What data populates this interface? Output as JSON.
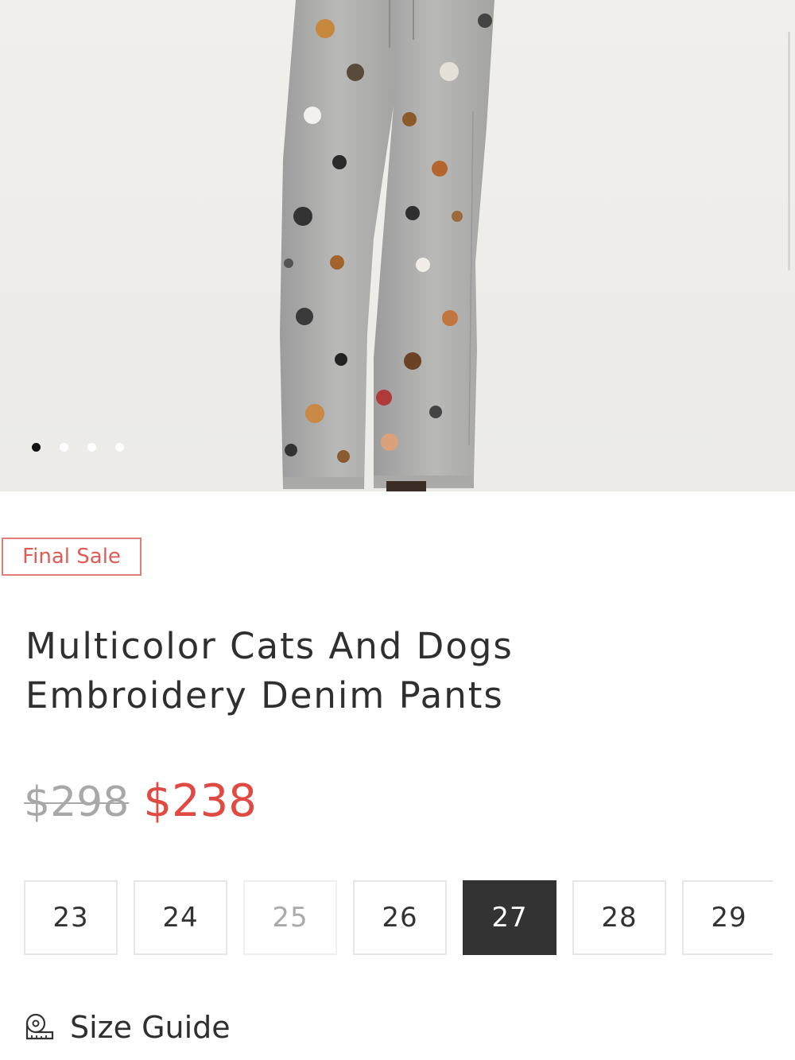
{
  "gallery": {
    "image_alt": "Gray denim pants with embroidered cat and dog faces",
    "slides": [
      {
        "active": true
      },
      {
        "active": false
      },
      {
        "active": false
      },
      {
        "active": false
      }
    ]
  },
  "badge": {
    "label": "Final Sale"
  },
  "product": {
    "title_line1": "Multicolor Cats And Dogs",
    "title_line2": "Embroidery Denim Pants",
    "original_price": "$298",
    "sale_price": "$238"
  },
  "sizes": [
    {
      "label": "23",
      "state": "available"
    },
    {
      "label": "24",
      "state": "available"
    },
    {
      "label": "25",
      "state": "unavailable"
    },
    {
      "label": "26",
      "state": "available"
    },
    {
      "label": "27",
      "state": "selected"
    },
    {
      "label": "28",
      "state": "available"
    },
    {
      "label": "29",
      "state": "available"
    }
  ],
  "size_guide": {
    "label": "Size Guide",
    "icon": "tape-measure-icon"
  },
  "colors": {
    "accent_red": "#e04a43",
    "badge_border": "#e07b76",
    "selected_bg": "#333333"
  }
}
